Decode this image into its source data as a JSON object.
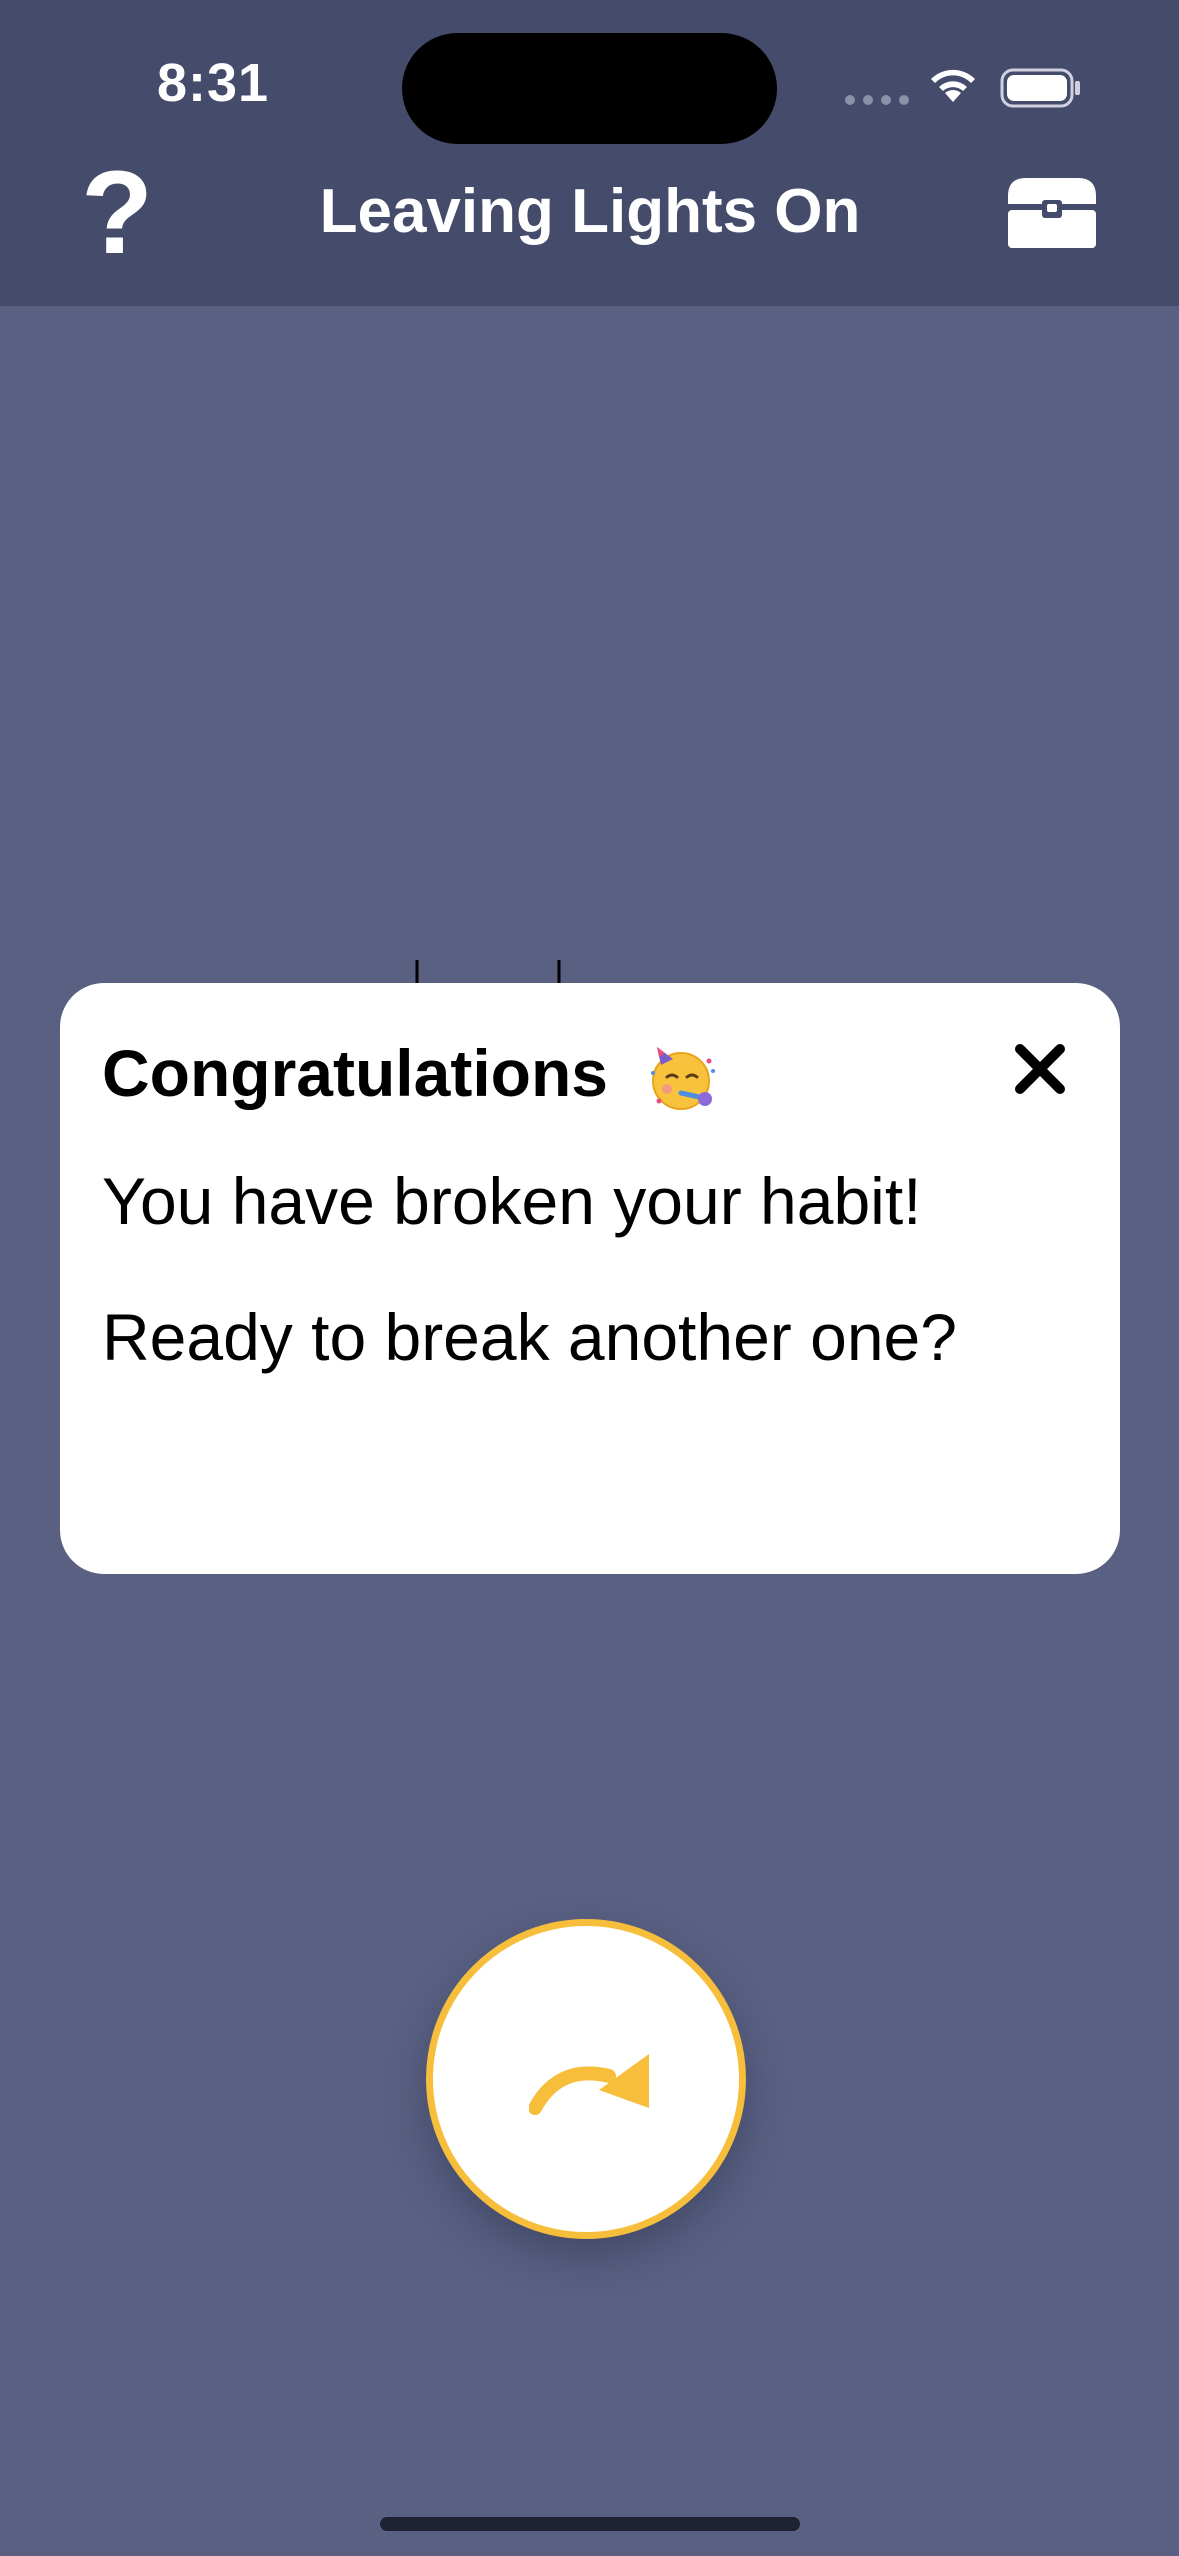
{
  "status_bar": {
    "time": "8:31"
  },
  "nav": {
    "title": "Leaving Lights On",
    "help_symbol": "?",
    "left_icon": "question-mark-icon",
    "right_icon": "treasure-chest-icon"
  },
  "dialog": {
    "title": "Congratulations",
    "title_emoji": "partying-face-icon",
    "line1": "You have broken your habit!",
    "line2": "Ready to break another one?"
  },
  "action": {
    "icon": "redo-arrow-icon"
  },
  "colors": {
    "background": "#596082",
    "header": "#454b6a",
    "accent": "#f6be3a",
    "dialog": "#ffffff"
  }
}
